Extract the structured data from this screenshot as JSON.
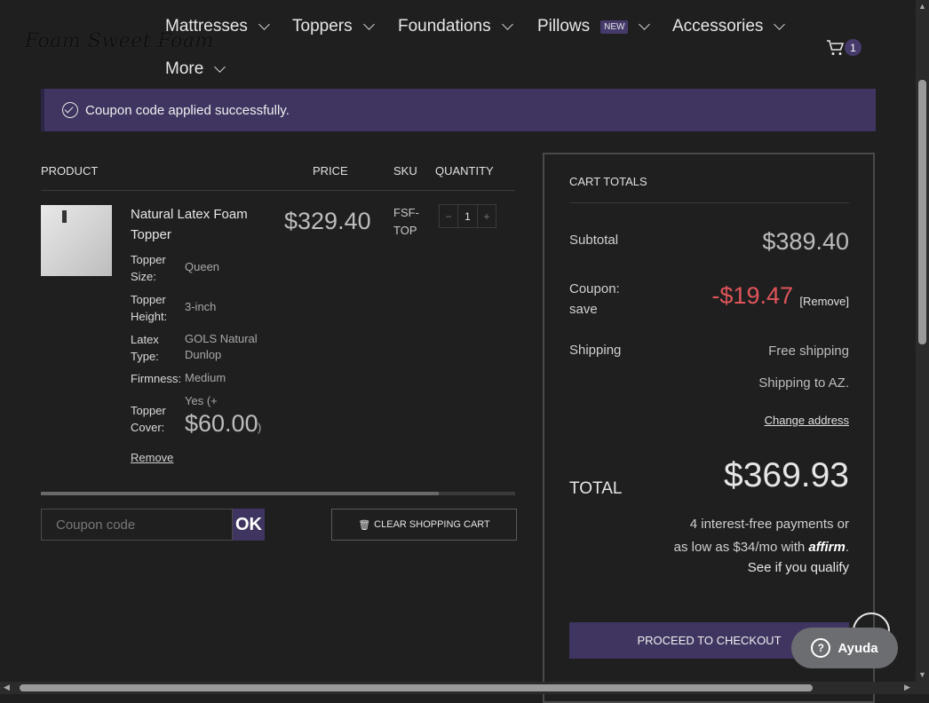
{
  "header": {
    "logo_text": "Foam Sweet Foam",
    "nav": [
      {
        "label": "Mattresses"
      },
      {
        "label": "Toppers"
      },
      {
        "label": "Foundations"
      },
      {
        "label": "Pillows",
        "badge": "NEW"
      },
      {
        "label": "Accessories"
      },
      {
        "label": "More"
      }
    ],
    "cart_count": "1"
  },
  "notice": {
    "message": "Coupon code applied successfully."
  },
  "table": {
    "headers": {
      "product": "PRODUCT",
      "price": "PRICE",
      "sku": "SKU",
      "quantity": "QUANTITY"
    },
    "item": {
      "name": "Natural Latex Foam Topper",
      "attributes": [
        {
          "key": "Topper Size:",
          "value": "Queen"
        },
        {
          "key": "Topper Height:",
          "value": "3-inch"
        },
        {
          "key": "Latex Type:",
          "value": "GOLS Natural Dunlop"
        },
        {
          "key": "Firmness:",
          "value": "Medium"
        },
        {
          "key": "Topper Cover:",
          "value_prefix": "Yes (+",
          "value_price": "$60.00",
          "value_suffix": ")"
        }
      ],
      "price": "$329.40",
      "sku": "FSF-TOP",
      "quantity": "1",
      "remove_label": "Remove"
    }
  },
  "coupon": {
    "placeholder": "Coupon code",
    "button_label": "OK"
  },
  "clear_cart_label": "CLEAR SHOPPING CART",
  "totals": {
    "title": "CART TOTALS",
    "subtotal_label": "Subtotal",
    "subtotal_value": "$389.40",
    "coupon_label": "Coupon: save",
    "coupon_value": "-$19.47",
    "coupon_remove": "[Remove]",
    "shipping_label": "Shipping",
    "shipping_value": "Free shipping",
    "shipping_to": "Shipping to AZ.",
    "change_address": "Change address",
    "total_label": "TOTAL",
    "total_value": "$369.93",
    "affirm_line1": "4 interest-free payments or",
    "affirm_line2": "as low as $34/mo with",
    "affirm_brand": "affirm",
    "affirm_qualify": "See if you qualify",
    "checkout_label": "PROCEED TO CHECKOUT"
  },
  "help": {
    "label": "Ayuda"
  },
  "colors": {
    "accent": "#3f3560",
    "background": "#1f1f20",
    "discount": "#e0555a"
  }
}
